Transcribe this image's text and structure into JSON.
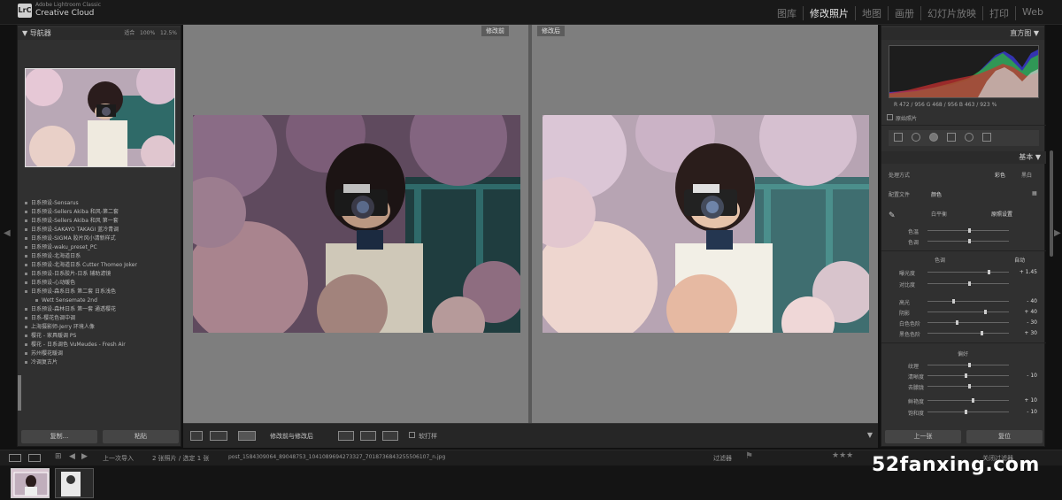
{
  "app": {
    "logo": "LrC",
    "name_small": "Adobe Lightroom Classic",
    "name": "Creative Cloud"
  },
  "modules": [
    "图库",
    "修改照片",
    "地图",
    "画册",
    "幻灯片放映",
    "打印",
    "Web"
  ],
  "active_module": "修改照片",
  "left_panel": {
    "navigator_title": "导航器",
    "navigator_zoom": [
      "适合",
      "100%",
      "12.5%"
    ],
    "presets": [
      "日系预设-Sensarus",
      "日系预设-Sellers Akiba 和风-第二套",
      "日系预设-Sellers Akiba 和风 第一套",
      "日系预设-SAKAYO TAKAGI 蓝冷青调",
      "日系预设-SIGMA 胶片风小清新样式",
      "日系预设-waku_preset_PC",
      "日系预设-北海道日系",
      "日系预设-北海道日系 Cutter Thomeo Joker",
      "日系预设-日系胶片-日系 辅助滤镜",
      "日系预设-心动暖色",
      "日系预设-森系日系 第二套 日系浅色",
      "Wett Sensemate 2nd",
      "日系预设-森林日系 第一套 通透樱花",
      "日系-樱花色调中调",
      "上海摄影师-Jerry 环境人像",
      "樱花 - 家具暖调 PS",
      "樱花 - 日系调色 VuMeudes - Fresh Air",
      "苏州樱花暖调",
      "冷调复古片"
    ],
    "copy_button": "复制...",
    "paste_button": "粘贴"
  },
  "center": {
    "before_label": "修改前",
    "after_label": "修改后",
    "toolbar_label": "修改前与修改后",
    "soft_proof_label": "软打样"
  },
  "right_panel": {
    "histogram_title": "直方图",
    "histogram_readout": "R 472 / 956   G 468 / 956   B 463 / 923 %",
    "original_photo_label": "原始照片",
    "basic_title": "基本",
    "treatment_label": "处理方式",
    "treatment_color": "彩色",
    "treatment_bw": "黑白",
    "profile_label": "配置文件",
    "profile_value": "颜色",
    "wb_label": "白平衡",
    "wb_value": "原照设置",
    "temp_label": "色温",
    "tint_label": "色调",
    "tone_label": "色调",
    "auto_label": "自动",
    "exposure_label": "曝光度",
    "exposure_value": "+ 1.45",
    "contrast_label": "对比度",
    "highlights_label": "高光",
    "highlights_value": "- 40",
    "shadows_label": "阴影",
    "shadows_value": "+ 40",
    "whites_label": "白色色阶",
    "whites_value": "- 30",
    "blacks_label": "黑色色阶",
    "blacks_value": "+ 30",
    "presence_label": "偏好",
    "texture_label": "纹理",
    "clarity_label": "清晰度",
    "clarity_value": "- 10",
    "dehaze_label": "去朦胧",
    "vibrance_label": "鲜艳度",
    "vibrance_value": "+ 10",
    "saturation_label": "饱和度",
    "saturation_value": "- 10",
    "previous_button": "上一张",
    "reset_button": "复位"
  },
  "filmstrip": {
    "source_label": "上一次导入",
    "count_label": "2 张照片 / 选定 1 张",
    "filename": "post_1584309064_89048753_1041089694273327_7018736843255506107_n.jpg",
    "filter_label": "过滤器",
    "filter_value": "关闭过滤器"
  },
  "watermark": "52fanxing.com"
}
